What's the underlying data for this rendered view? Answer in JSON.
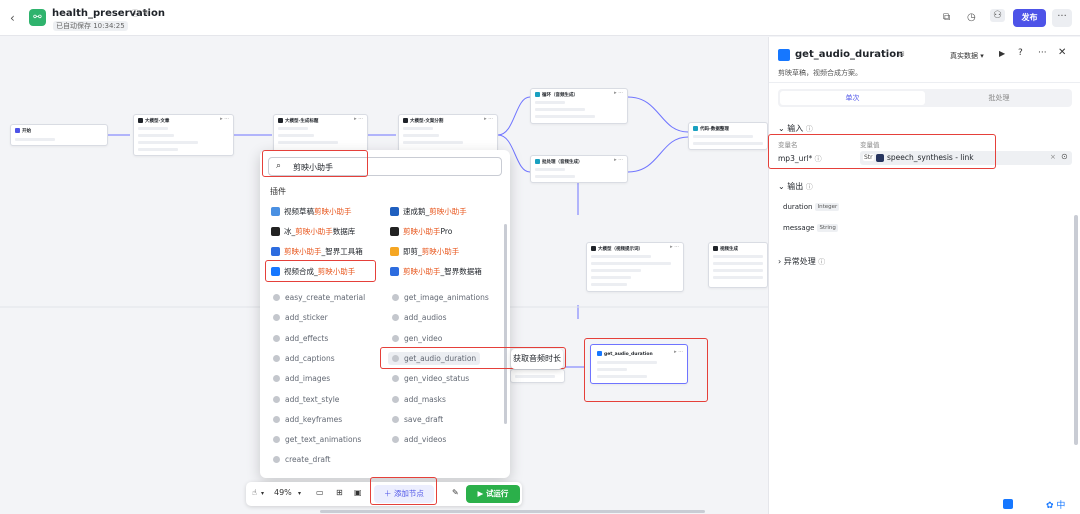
{
  "header": {
    "title": "health_preservation",
    "saved_text": "已自动保存 10:34:25",
    "publish_label": "发布",
    "more_label": "···"
  },
  "canvas": {
    "nodes": [
      {
        "title": "开始"
      },
      {
        "title": "大模型-文章"
      },
      {
        "title": "大模型-生成标题"
      },
      {
        "title": "大模型-文案分割"
      },
      {
        "title": "循环（音频生成）"
      },
      {
        "title": "批处理（音频生成）"
      },
      {
        "title": "代码-数据整理"
      },
      {
        "title": "大模型（视频提示词）"
      },
      {
        "title": "视频生成"
      },
      {
        "title": "get_audio_duration"
      }
    ]
  },
  "popup": {
    "search_value": "剪映小助手",
    "section_label": "插件",
    "plugins": [
      {
        "pre": "视频草稿",
        "hl": "剪映小助手",
        "post": "",
        "color": "#4a90e2"
      },
      {
        "pre": "速成鹅_",
        "hl": "剪映小助手",
        "post": "",
        "color": "#1f5fbf"
      },
      {
        "pre": "冰_",
        "hl": "剪映小助手",
        "post": "数据库",
        "color": "#222222"
      },
      {
        "pre": "",
        "hl": "剪映小助手",
        "post": "Pro",
        "color": "#222222"
      },
      {
        "pre": "",
        "hl": "剪映小助手",
        "post": "_智界工具箱",
        "color": "#2d6cdf"
      },
      {
        "pre": "即剪_",
        "hl": "剪映小助手",
        "post": "",
        "color": "#f5a623"
      },
      {
        "pre": "视频合成_",
        "hl": "剪映小助手",
        "post": "",
        "color": "#1677ff"
      },
      {
        "pre": "",
        "hl": "剪映小助手",
        "post": "_智界数据箱",
        "color": "#2d6cdf"
      }
    ],
    "tools": [
      "easy_create_material",
      "get_image_animations",
      "add_sticker",
      "add_audios",
      "add_effects",
      "gen_video",
      "add_captions",
      "get_audio_duration",
      "add_images",
      "gen_video_status",
      "add_text_style",
      "add_masks",
      "add_keyframes",
      "save_draft",
      "get_text_animations",
      "add_videos",
      "create_draft"
    ],
    "tooltip": "获取音频时长"
  },
  "toolbar": {
    "zoom": "49%",
    "add_node_label": "添加节点",
    "run_label": "试运行"
  },
  "panel": {
    "title": "get_audio_duration",
    "description": "剪映草稿，视频合成方案。",
    "data_source": "真实数据",
    "tabs": [
      "单次",
      "批处理"
    ],
    "input_section": "输入",
    "col_name": "变量名",
    "col_value": "变量值",
    "input_name": "mp3_url*",
    "input_type": "Str",
    "input_ref": "speech_synthesis - link",
    "output_section": "输出",
    "outputs": [
      {
        "name": "duration",
        "type": "Integer"
      },
      {
        "name": "message",
        "type": "String"
      }
    ],
    "exception_section": "异常处理"
  },
  "ime": {
    "label": "中"
  }
}
